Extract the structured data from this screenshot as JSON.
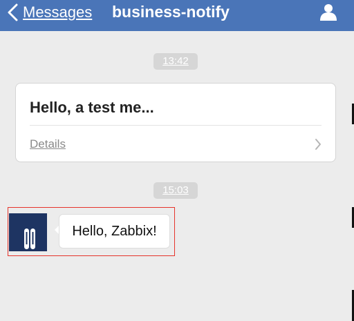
{
  "navbar": {
    "back_label": "Messages",
    "title": "business-notify",
    "back_icon": "chevron-left-icon",
    "contact_icon": "person-icon",
    "background_color": "#4a75b8"
  },
  "conversation": {
    "timestamps": [
      "13:42",
      "15:03"
    ],
    "card": {
      "title": "Hello, a test me...",
      "details_label": "Details",
      "chevron_icon": "chevron-right-icon"
    },
    "message": {
      "text": "Hello, Zabbix!",
      "avatar_icon": "app-logo-icon",
      "highlight_color": "#e6332a"
    }
  }
}
